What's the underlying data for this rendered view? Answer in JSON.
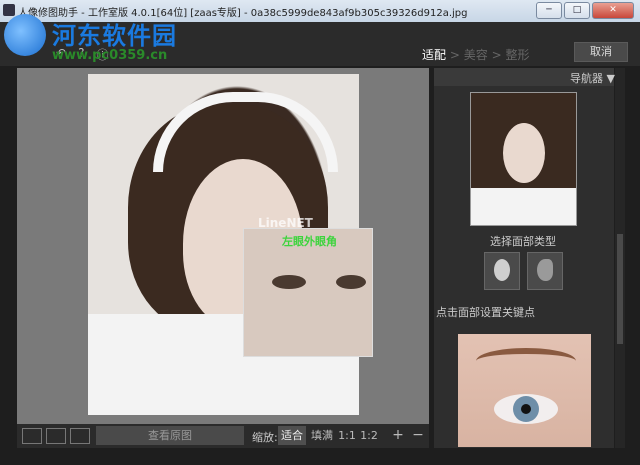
{
  "window": {
    "title": "人像修图助手 - 工作室版 4.0.1[64位] [zaas专版] - 0a38c5999de843af9b305c39326d912a.jpg",
    "minimize_glyph": "─",
    "maximize_glyph": "□",
    "close_glyph": "✕"
  },
  "watermark": {
    "title": "河东软件园",
    "url": "www.pc0359.cn",
    "magnifier_mark": "LineNET"
  },
  "toolbar": {
    "icons": [
      "undo-icon",
      "help-icon",
      "info-icon"
    ],
    "help_glyph": "?",
    "info_glyph": "ⓘ",
    "undo_glyph": "↶"
  },
  "steps": {
    "step1": "适配",
    "sep1": ">",
    "step2": "美容",
    "sep2": ">",
    "step3": "整形"
  },
  "cancel_label": "取消",
  "magnifier_label": "左眼外眼角",
  "bottombar": {
    "view_original": "查看原图",
    "zoom_label": "缩放:",
    "zoom_options": [
      "适合",
      "填满",
      "1:1",
      "1:2",
      "+",
      "−"
    ],
    "zoom_selected": "适合"
  },
  "navigator": {
    "title": "导航器 ▼"
  },
  "face_type_label": "选择面部类型",
  "keypoint_label": "点击面部设置关键点",
  "colors": {
    "accent_green": "#3cd43c",
    "panel_bg": "#2b2b2b",
    "title_blue": "#1a7ae0"
  }
}
